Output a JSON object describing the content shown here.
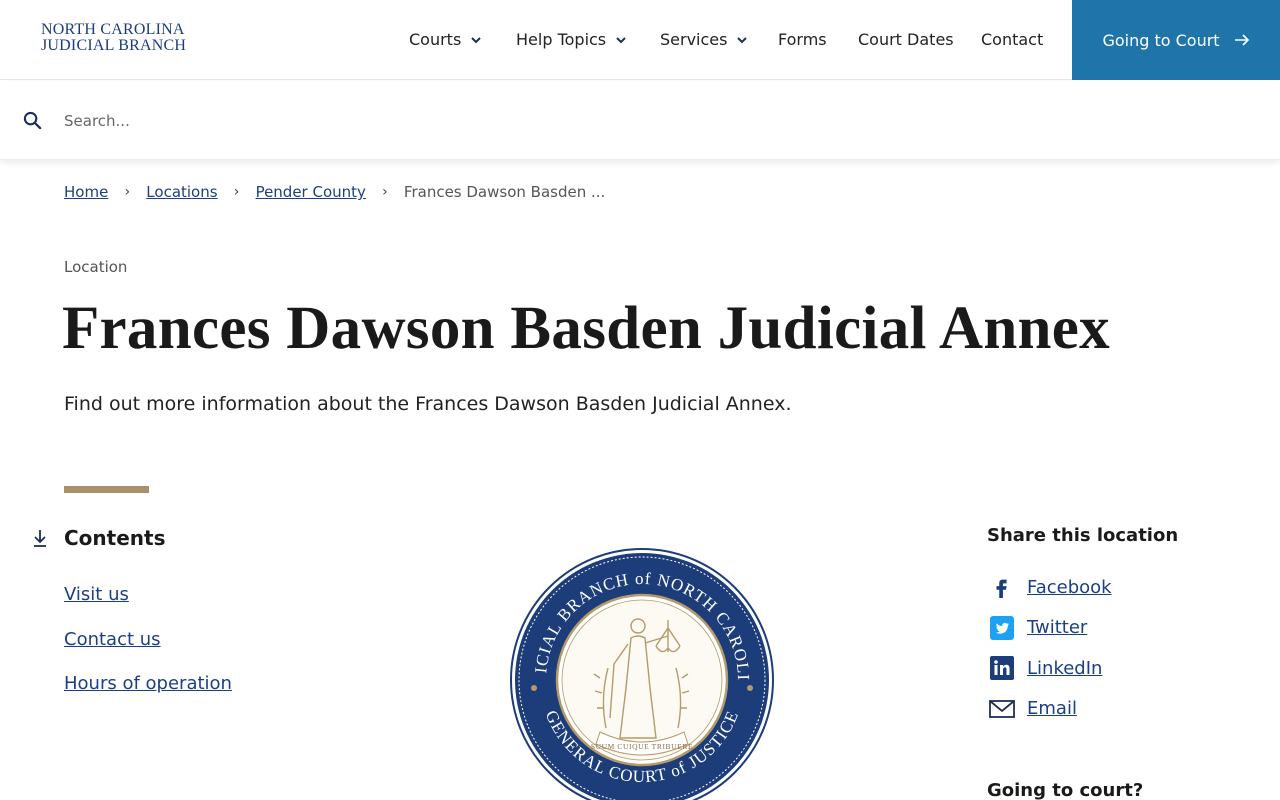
{
  "header": {
    "logo_line1": "NORTH CAROLINA",
    "logo_line2": "JUDICIAL BRANCH",
    "nav": [
      {
        "label": "Courts",
        "has_dropdown": true
      },
      {
        "label": "Help Topics",
        "has_dropdown": true
      },
      {
        "label": "Services",
        "has_dropdown": true
      },
      {
        "label": "Forms",
        "has_dropdown": false
      },
      {
        "label": "Court Dates",
        "has_dropdown": false
      },
      {
        "label": "Contact",
        "has_dropdown": false
      }
    ],
    "cta_label": "Going to Court",
    "cta_color": "#1f75aa"
  },
  "search": {
    "placeholder": "Search...",
    "value": ""
  },
  "breadcrumb": {
    "items": [
      "Home",
      "Locations",
      "Pender County"
    ],
    "current": "Frances Dawson Basden ..."
  },
  "page": {
    "eyebrow": "Location",
    "title": "Frances Dawson Basden Judicial Annex",
    "lede": "Find out more information about the Frances Dawson Basden Judicial Annex.",
    "accent_color": "#a8916a"
  },
  "contents": {
    "title": "Contents",
    "items": [
      "Visit us",
      "Contact us",
      "Hours of operation"
    ]
  },
  "seal": {
    "top_text": "JUDICIAL BRANCH of NORTH CAROLINA",
    "bottom_text": "GENERAL COURT of JUSTICE",
    "motto": "SUUM CUIQUE TRIBUERE"
  },
  "share": {
    "title": "Share this location",
    "items": [
      {
        "label": "Facebook",
        "icon": "facebook-icon"
      },
      {
        "label": "Twitter",
        "icon": "twitter-icon"
      },
      {
        "label": "LinkedIn",
        "icon": "linkedin-icon"
      },
      {
        "label": "Email",
        "icon": "email-icon"
      }
    ]
  },
  "going_to_court": {
    "title": "Going to court?"
  }
}
